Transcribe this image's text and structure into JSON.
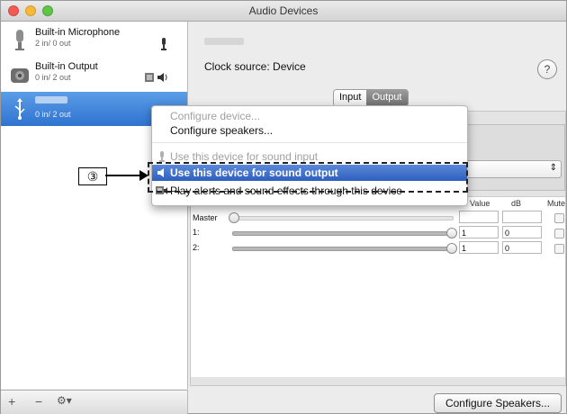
{
  "window": {
    "title": "Audio Devices"
  },
  "sidebar": {
    "devices": [
      {
        "name": "Built-in Microphone",
        "io": "2 in/ 0 out",
        "icon": "microphone-icon"
      },
      {
        "name": "Built-in Output",
        "io": "0 in/ 2 out",
        "icon": "speaker-icon"
      },
      {
        "name": "",
        "io": "0 in/ 2 out",
        "icon": "usb-icon",
        "selected": true
      }
    ],
    "bottom": {
      "add": "+",
      "remove": "−",
      "gear": "⚙▾"
    }
  },
  "main": {
    "clock_label": "Clock source: Device",
    "help": "?",
    "tabs": [
      {
        "label": "Input"
      },
      {
        "label": "Output",
        "active": true
      }
    ],
    "table": {
      "headers": [
        "Value",
        "dB",
        "Mute"
      ],
      "rows": [
        {
          "label": "Master",
          "value": "",
          "db": "",
          "level": 0.0
        },
        {
          "label": "1:",
          "value": "1",
          "db": "0",
          "level": 1.0
        },
        {
          "label": "2:",
          "value": "1",
          "db": "0",
          "level": 1.0
        }
      ]
    },
    "configure_speakers_button": "Configure Speakers..."
  },
  "menu": {
    "items": [
      {
        "label": "Configure device...",
        "enabled": false
      },
      {
        "label": "Configure speakers...",
        "enabled": true
      },
      {
        "label": "Use this device for sound input",
        "enabled": false
      },
      {
        "label": "Use this device for sound output",
        "enabled": true,
        "highlighted": true
      },
      {
        "label": "Play alerts and sound effects through this device",
        "enabled": true
      }
    ]
  },
  "annotation": {
    "callout": "③"
  },
  "colors": {
    "selection": "#2f73d0",
    "menu_highlight": "#2e5fbf"
  }
}
